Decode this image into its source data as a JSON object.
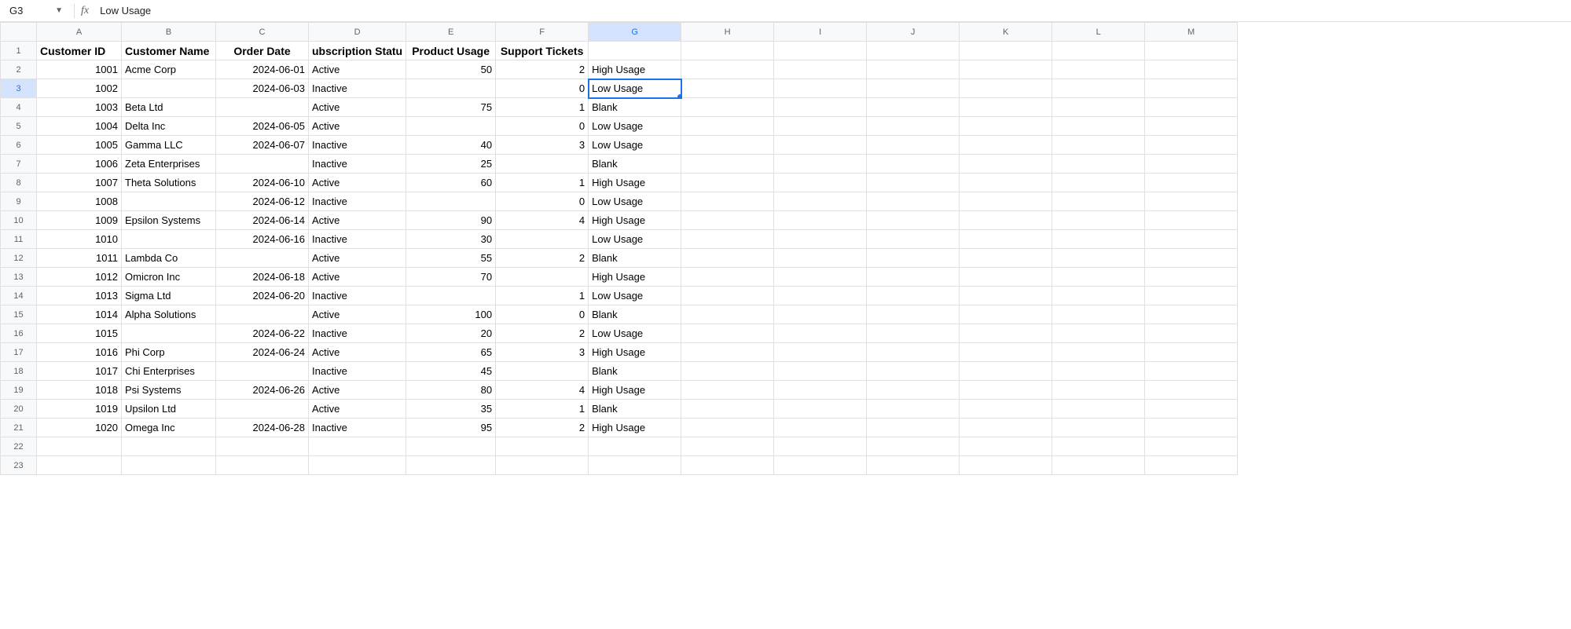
{
  "namebox": {
    "cell_ref": "G3",
    "fx_label": "fx"
  },
  "formula_bar": {
    "value": "Low Usage"
  },
  "columns": [
    "A",
    "B",
    "C",
    "D",
    "E",
    "F",
    "G",
    "H",
    "I",
    "J",
    "K",
    "L",
    "M"
  ],
  "selected_col": "G",
  "selected_row": 3,
  "row_count": 23,
  "headers": {
    "A": "Customer ID",
    "B": "Customer Name",
    "C": "Order Date",
    "D": "ubscription Statu",
    "E": "Product Usage",
    "F": "Support Tickets",
    "G": ""
  },
  "rows": [
    {
      "A": "1001",
      "B": "Acme Corp",
      "C": "2024-06-01",
      "D": "Active",
      "E": "50",
      "F": "2",
      "G": "High Usage"
    },
    {
      "A": "1002",
      "B": "",
      "C": "2024-06-03",
      "D": "Inactive",
      "E": "",
      "F": "0",
      "G": "Low Usage"
    },
    {
      "A": "1003",
      "B": "Beta Ltd",
      "C": "",
      "D": "Active",
      "E": "75",
      "F": "1",
      "G": "Blank"
    },
    {
      "A": "1004",
      "B": "Delta Inc",
      "C": "2024-06-05",
      "D": "Active",
      "E": "",
      "F": "0",
      "G": "Low Usage"
    },
    {
      "A": "1005",
      "B": "Gamma LLC",
      "C": "2024-06-07",
      "D": "Inactive",
      "E": "40",
      "F": "3",
      "G": "Low Usage"
    },
    {
      "A": "1006",
      "B": "Zeta Enterprises",
      "C": "",
      "D": "Inactive",
      "E": "25",
      "F": "",
      "G": "Blank"
    },
    {
      "A": "1007",
      "B": "Theta Solutions",
      "C": "2024-06-10",
      "D": "Active",
      "E": "60",
      "F": "1",
      "G": "High Usage"
    },
    {
      "A": "1008",
      "B": "",
      "C": "2024-06-12",
      "D": "Inactive",
      "E": "",
      "F": "0",
      "G": "Low Usage"
    },
    {
      "A": "1009",
      "B": "Epsilon Systems",
      "C": "2024-06-14",
      "D": "Active",
      "E": "90",
      "F": "4",
      "G": "High Usage"
    },
    {
      "A": "1010",
      "B": "",
      "C": "2024-06-16",
      "D": "Inactive",
      "E": "30",
      "F": "",
      "G": "Low Usage"
    },
    {
      "A": "1011",
      "B": "Lambda Co",
      "C": "",
      "D": "Active",
      "E": "55",
      "F": "2",
      "G": "Blank"
    },
    {
      "A": "1012",
      "B": "Omicron Inc",
      "C": "2024-06-18",
      "D": "Active",
      "E": "70",
      "F": "",
      "G": "High Usage"
    },
    {
      "A": "1013",
      "B": "Sigma Ltd",
      "C": "2024-06-20",
      "D": "Inactive",
      "E": "",
      "F": "1",
      "G": "Low Usage"
    },
    {
      "A": "1014",
      "B": "Alpha Solutions",
      "C": "",
      "D": "Active",
      "E": "100",
      "F": "0",
      "G": "Blank"
    },
    {
      "A": "1015",
      "B": "",
      "C": "2024-06-22",
      "D": "Inactive",
      "E": "20",
      "F": "2",
      "G": "Low Usage"
    },
    {
      "A": "1016",
      "B": "Phi Corp",
      "C": "2024-06-24",
      "D": "Active",
      "E": "65",
      "F": "3",
      "G": "High Usage"
    },
    {
      "A": "1017",
      "B": "Chi Enterprises",
      "C": "",
      "D": "Inactive",
      "E": "45",
      "F": "",
      "G": "Blank"
    },
    {
      "A": "1018",
      "B": "Psi Systems",
      "C": "2024-06-26",
      "D": "Active",
      "E": "80",
      "F": "4",
      "G": "High Usage"
    },
    {
      "A": "1019",
      "B": "Upsilon Ltd",
      "C": "",
      "D": "Active",
      "E": "35",
      "F": "1",
      "G": "Blank"
    },
    {
      "A": "1020",
      "B": "Omega Inc",
      "C": "2024-06-28",
      "D": "Inactive",
      "E": "95",
      "F": "2",
      "G": "High Usage"
    }
  ]
}
